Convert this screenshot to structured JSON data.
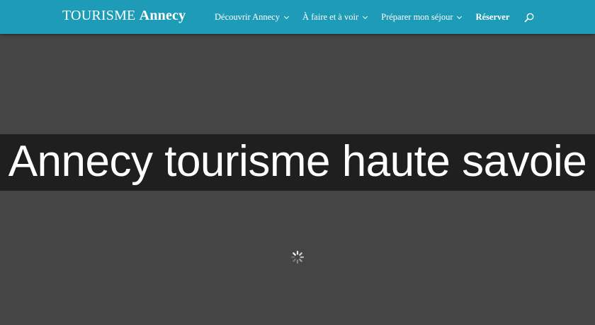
{
  "header": {
    "logo_light": "TOURISME ",
    "logo_bold": "Annecy",
    "nav": [
      {
        "label": "Découvrir Annecy"
      },
      {
        "label": "À faire et à voir"
      },
      {
        "label": "Préparer mon séjour"
      },
      {
        "label": "Réserver"
      }
    ],
    "search_icon": "search-icon"
  },
  "banner": {
    "title": "Annecy tourisme haute savoie"
  },
  "loader": {
    "icon": "loading-spinner-icon"
  },
  "colors": {
    "topbar": "#1e9bb7",
    "page_bg": "#454545",
    "banner_bg": "#1f1f1f",
    "text": "#ffffff"
  }
}
